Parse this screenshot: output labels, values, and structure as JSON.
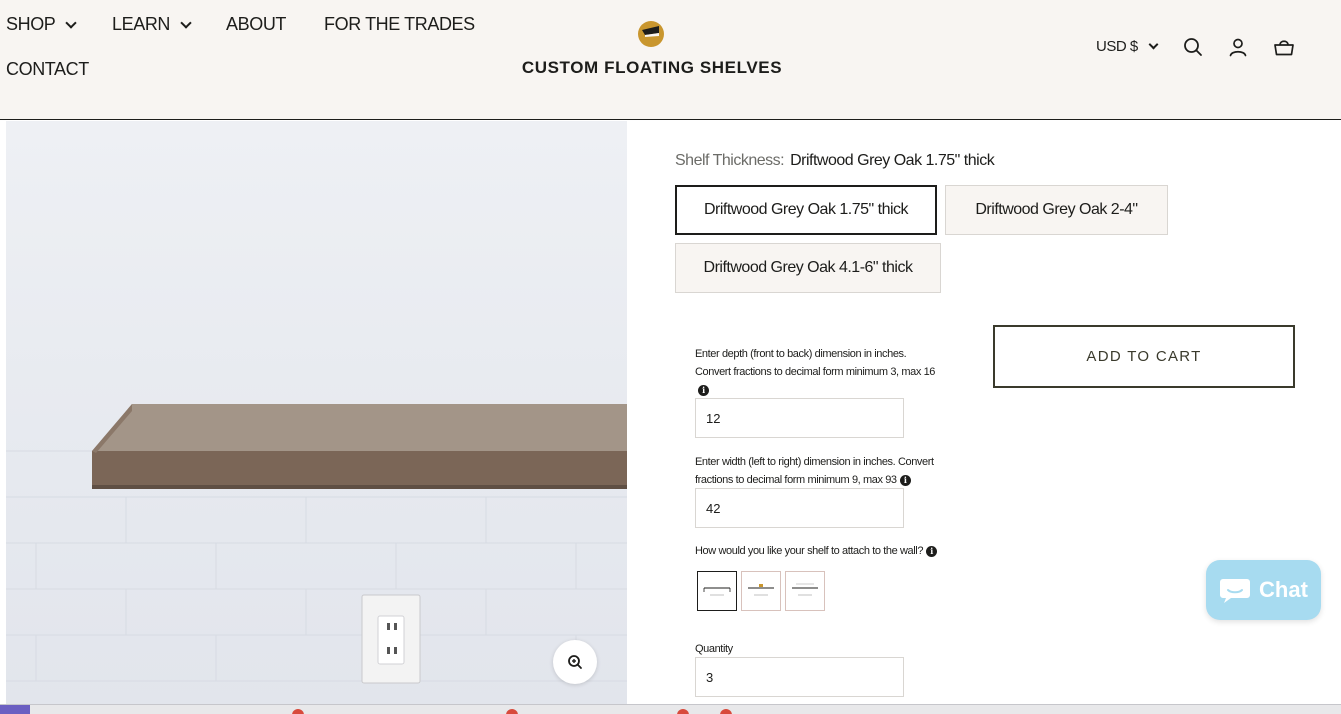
{
  "nav": {
    "shop": "SHOP",
    "learn": "LEARN",
    "about": "ABOUT",
    "trades": "FOR THE TRADES",
    "contact": "CONTACT"
  },
  "brand": {
    "name": "CUSTOM FLOATING SHELVES"
  },
  "header_actions": {
    "currency": "USD $",
    "icons": [
      "search-icon",
      "account-icon",
      "cart-icon"
    ]
  },
  "product": {
    "variant_key": "Shelf Thickness:",
    "variant_value": "Driftwood Grey Oak 1.75\" thick",
    "options": [
      "Driftwood Grey Oak 1.75\" thick",
      "Driftwood Grey Oak 2-4\"",
      "Driftwood Grey Oak 4.1-6\" thick"
    ],
    "selected_option_index": 0,
    "depth_help_line1": "Enter depth (front to back) dimension in inches.",
    "depth_help_line2": "Convert fractions to decimal form minimum 3, max 16",
    "depth_value": "12",
    "width_help_line1": "Enter width (left to right) dimension in inches. Convert",
    "width_help_line2": "fractions to decimal form minimum 9, max 93",
    "width_value": "42",
    "attach_question": "How would you like your shelf to attach to the wall?",
    "attach_selected_index": 0,
    "quantity_label": "Quantity",
    "quantity_value": "3",
    "add_to_cart": "ADD TO CART"
  },
  "chat": {
    "label": "Chat"
  },
  "colors": {
    "header_bg": "#f8f5f2",
    "text": "#1d1d1b",
    "chat_bg": "#a7dbf0",
    "shelf_wood": "#7b6657"
  }
}
